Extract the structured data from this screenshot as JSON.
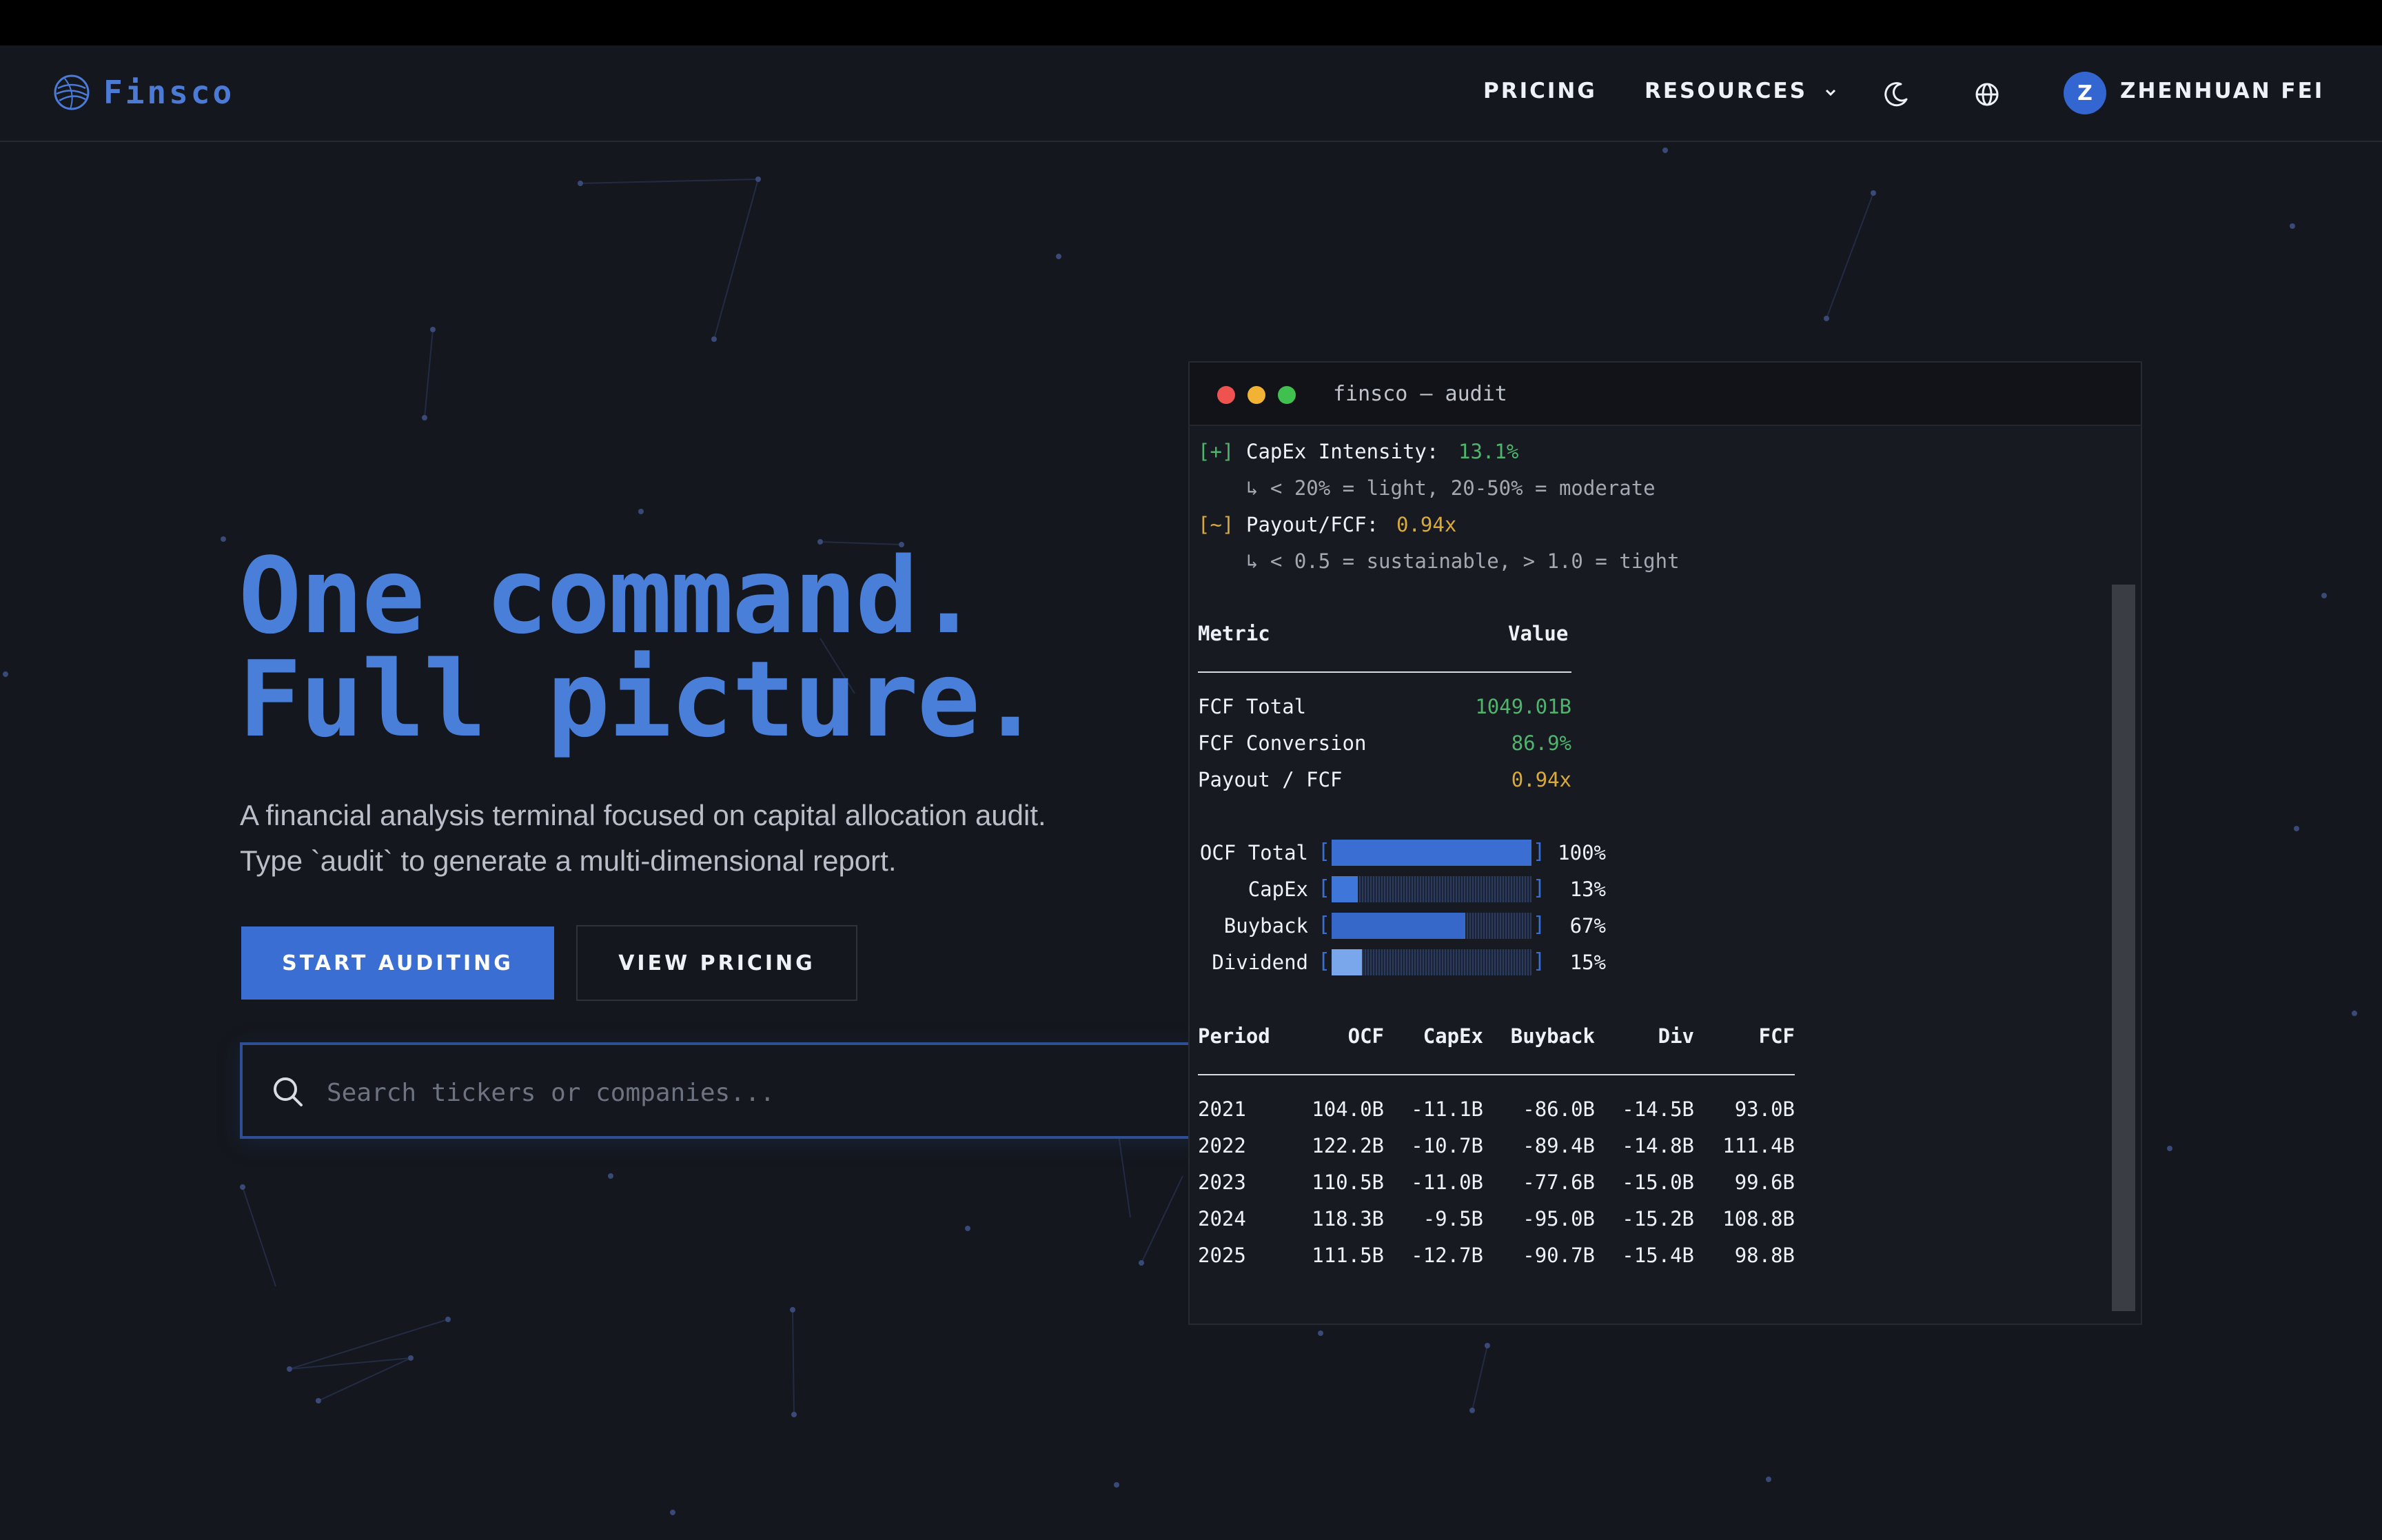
{
  "brand": {
    "name": "Finsco"
  },
  "nav": {
    "pricing": "PRICING",
    "resources": "RESOURCES",
    "user_initial": "Z",
    "user_name": "ZHENHUAN FEI",
    "icons": [
      "moon-icon",
      "globe-icon",
      "chevron-down-icon"
    ]
  },
  "hero": {
    "title_line1": "One command.",
    "title_line2": "Full picture.",
    "subtitle": "A financial analysis terminal focused on capital allocation audit. Type `audit` to generate a multi-dimensional report.",
    "primary_button": "START AUDITING",
    "secondary_button": "VIEW PRICING",
    "search_placeholder": "Search tickers or companies..."
  },
  "colors": {
    "accent": "#3a6ed2",
    "title": "#4a7fd9",
    "green": "#4fb56d",
    "yellow": "#d9a93c",
    "bg": "#14171d"
  },
  "terminal": {
    "title": "finsco — audit",
    "checks": [
      {
        "marker": "[+]",
        "label": "CapEx Intensity:",
        "value": "13.1%",
        "hint": "↳ < 20% = light, 20-50% = moderate",
        "status": "green"
      },
      {
        "marker": "[~]",
        "label": "Payout/FCF:",
        "value": "0.94x",
        "hint": "↳ < 0.5 = sustainable, > 1.0 = tight",
        "status": "yellow"
      }
    ],
    "summary": {
      "headers": [
        "Metric",
        "Value"
      ],
      "rows": [
        {
          "metric": "FCF Total",
          "value": "1049.01B",
          "status": "green"
        },
        {
          "metric": "FCF Conversion",
          "value": "86.9%",
          "status": "green"
        },
        {
          "metric": "Payout / FCF",
          "value": "0.94x",
          "status": "yellow"
        }
      ]
    },
    "bars": [
      {
        "label": "OCF Total",
        "pct": 100,
        "pct_label": "100%",
        "color": "#3a6ed2"
      },
      {
        "label": "CapEx",
        "pct": 13,
        "pct_label": "13%",
        "color": "#3f76da"
      },
      {
        "label": "Buyback",
        "pct": 67,
        "pct_label": "67%",
        "color": "#3568c9"
      },
      {
        "label": "Dividend",
        "pct": 15,
        "pct_label": "15%",
        "color": "#7aa7ec"
      }
    ],
    "table": {
      "headers": [
        "Period",
        "OCF",
        "CapEx",
        "Buyback",
        "Div",
        "FCF"
      ],
      "rows": [
        [
          "2021",
          "104.0B",
          "-11.1B",
          "-86.0B",
          "-14.5B",
          "93.0B"
        ],
        [
          "2022",
          "122.2B",
          "-10.7B",
          "-89.4B",
          "-14.8B",
          "111.4B"
        ],
        [
          "2023",
          "110.5B",
          "-11.0B",
          "-77.6B",
          "-15.0B",
          "99.6B"
        ],
        [
          "2024",
          "118.3B",
          "-9.5B",
          "-95.0B",
          "-15.2B",
          "108.8B"
        ],
        [
          "2025",
          "111.5B",
          "-12.7B",
          "-90.7B",
          "-15.4B",
          "98.8B"
        ]
      ]
    }
  }
}
